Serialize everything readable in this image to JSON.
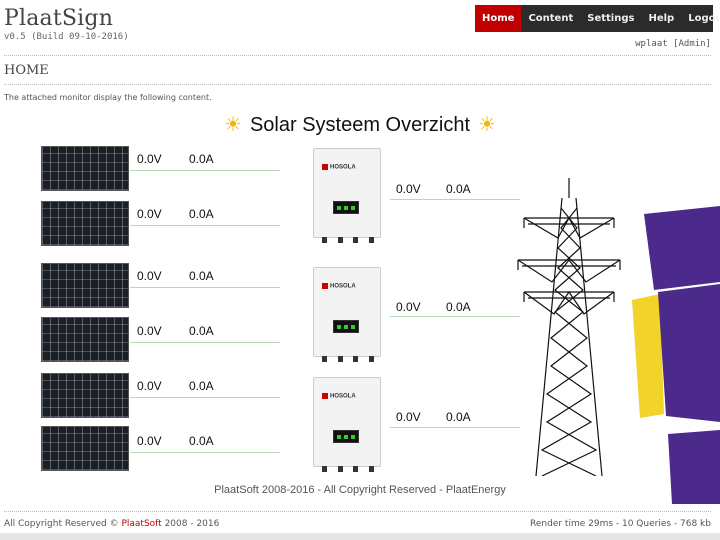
{
  "app": {
    "title": "PlaatSign",
    "version": "v0.5 (Build 09-10-2016)"
  },
  "nav": {
    "items": [
      {
        "label": "Home",
        "active": true
      },
      {
        "label": "Content",
        "active": false
      },
      {
        "label": "Settings",
        "active": false
      },
      {
        "label": "Help",
        "active": false
      },
      {
        "label": "Logout",
        "active": false
      }
    ]
  },
  "user": {
    "label": "wplaat [Admin]"
  },
  "page": {
    "title": "HOME",
    "intro": "The attached monitor display the following content."
  },
  "monitor": {
    "title": "Solar Systeem Overzicht",
    "panels": [
      {
        "voltage": "0.0V",
        "current": "0.0A"
      },
      {
        "voltage": "0.0V",
        "current": "0.0A"
      },
      {
        "voltage": "0.0V",
        "current": "0.0A"
      },
      {
        "voltage": "0.0V",
        "current": "0.0A"
      },
      {
        "voltage": "0.0V",
        "current": "0.0A"
      },
      {
        "voltage": "0.0V",
        "current": "0.0A"
      }
    ],
    "inverters": [
      {
        "brand": "HOSOLA",
        "voltage": "0.0V",
        "current": "0.0A"
      },
      {
        "brand": "HOSOLA",
        "voltage": "0.0V",
        "current": "0.0A"
      },
      {
        "brand": "HOSOLA",
        "voltage": "0.0V",
        "current": "0.0A"
      }
    ],
    "footer": "PlaatSoft 2008-2016 - All Copyright Reserved - PlaatEnergy"
  },
  "footer": {
    "copyright_prefix": "All Copyright Reserved © ",
    "copyright_brand": "PlaatSoft",
    "copyright_years": " 2008 - 2016",
    "stats": "Render time 29ms - 10 Queries - 768 kb"
  },
  "colors": {
    "accent": "#c00000",
    "nav_bg": "#2b2b2b",
    "sun": "#f4b400",
    "deco_purple": "#4b2a8c",
    "deco_yellow": "#f2d32a"
  },
  "icons": {
    "sun": "sun-icon",
    "tower": "power-tower-icon",
    "solar_panel": "solar-panel-icon",
    "inverter": "inverter-icon"
  }
}
